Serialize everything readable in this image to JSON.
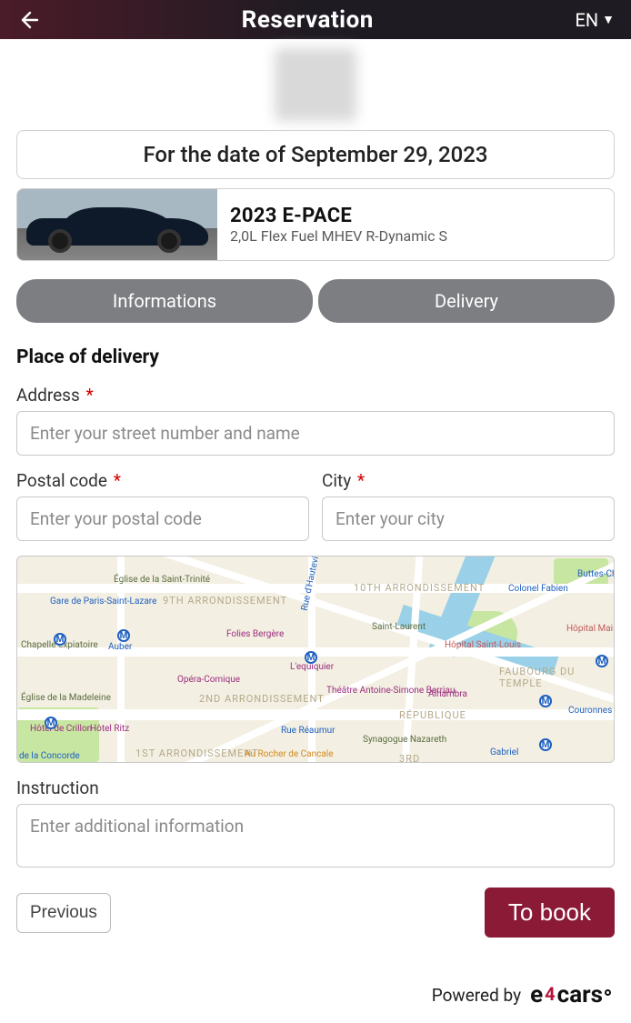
{
  "header": {
    "title": "Reservation",
    "language": "EN"
  },
  "date_banner": "For the date of September 29, 2023",
  "vehicle": {
    "name": "2023 E-PACE",
    "subtitle": "2,0L Flex Fuel MHEV R-Dynamic S"
  },
  "tabs": {
    "info": "Informations",
    "delivery": "Delivery"
  },
  "delivery": {
    "section_title": "Place of delivery",
    "address_label": "Address",
    "address_placeholder": "Enter your street number and name",
    "postal_label": "Postal code",
    "postal_placeholder": "Enter your postal code",
    "city_label": "City",
    "city_placeholder": "Enter your city",
    "instruction_label": "Instruction",
    "instruction_placeholder": "Enter additional information"
  },
  "map": {
    "arr_9": "9TH ARRONDISSEMENT",
    "arr_10": "10TH ARRONDISSEMENT",
    "arr_2": "2ND ARRONDISSEMENT",
    "arr_1": "1ST ARRONDISSEMENT",
    "arr_3": "3RD",
    "poi": {
      "gare": "Gare de Paris-Saint-Lazare",
      "trinite": "Église de la Saint-Trinité",
      "folies": "Folies Bergère",
      "auber": "Auber",
      "expiatoire": "Chapelle expiatoire",
      "opera": "Opéra-Comique",
      "madeleine": "Église de la Madeleine",
      "ritz": "Hôtel Ritz",
      "crillon": "Hôtel de Crillon",
      "concorde": "de la Concorde",
      "reaumur": "Rue Réaumur",
      "rocher": "Au Rocher de Cancale",
      "lequiquier": "L'equiquier",
      "hauteville": "Rue d'Hauteville",
      "stlaurent": "Saint-Laurent",
      "stlouis": "Hôpital Saint-Louis",
      "blanche": "Hôpital Maison Blanche",
      "fabien": "Colonel Fabien",
      "theatre": "Théâtre Antoine-Simone Berriau",
      "alhambra": "Alhambra",
      "republique": "RÉPUBLIQUE",
      "nazareth": "Synagogue Nazareth",
      "gabriel": "Gabriel",
      "couronnes": "Couronnes",
      "butte": "Buttes-Chaumont",
      "faubourg": "FAUBOURG DU TEMPLE"
    }
  },
  "actions": {
    "previous": "Previous",
    "book": "To book"
  },
  "footer": {
    "powered": "Powered by",
    "brand_e": "e",
    "brand_4": "4",
    "brand_cars": "cars"
  },
  "required_mark": "*"
}
